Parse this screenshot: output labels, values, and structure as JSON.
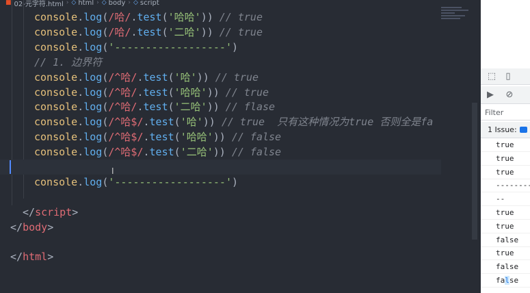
{
  "breadcrumb": {
    "file": "02-元字符.html",
    "html": "html",
    "body": "body",
    "script": "script"
  },
  "code": [
    [
      [
        "t-obj",
        "console"
      ],
      [
        "t-punc",
        "."
      ],
      [
        "t-fn",
        "log"
      ],
      [
        "t-punc",
        "("
      ],
      [
        "t-re",
        "/哈/"
      ],
      [
        "t-punc",
        "."
      ],
      [
        "t-fn",
        "test"
      ],
      [
        "t-punc",
        "("
      ],
      [
        "t-str",
        "'哈哈'"
      ],
      [
        "t-punc",
        "))"
      ],
      [
        "t-comment",
        " // true"
      ]
    ],
    [
      [
        "t-obj",
        "console"
      ],
      [
        "t-punc",
        "."
      ],
      [
        "t-fn",
        "log"
      ],
      [
        "t-punc",
        "("
      ],
      [
        "t-re",
        "/哈/"
      ],
      [
        "t-punc",
        "."
      ],
      [
        "t-fn",
        "test"
      ],
      [
        "t-punc",
        "("
      ],
      [
        "t-str",
        "'二哈'"
      ],
      [
        "t-punc",
        "))"
      ],
      [
        "t-comment",
        " // true"
      ]
    ],
    [
      [
        "t-obj",
        "console"
      ],
      [
        "t-punc",
        "."
      ],
      [
        "t-fn",
        "log"
      ],
      [
        "t-punc",
        "("
      ],
      [
        "t-str",
        "'------------------'"
      ],
      [
        "t-punc",
        ")"
      ]
    ],
    [
      [
        "t-comment",
        "// 1. 边界符"
      ]
    ],
    [
      [
        "t-obj",
        "console"
      ],
      [
        "t-punc",
        "."
      ],
      [
        "t-fn",
        "log"
      ],
      [
        "t-punc",
        "("
      ],
      [
        "t-re",
        "/^哈/"
      ],
      [
        "t-punc",
        "."
      ],
      [
        "t-fn",
        "test"
      ],
      [
        "t-punc",
        "("
      ],
      [
        "t-str",
        "'哈'"
      ],
      [
        "t-punc",
        "))"
      ],
      [
        "t-comment",
        " // true"
      ]
    ],
    [
      [
        "t-obj",
        "console"
      ],
      [
        "t-punc",
        "."
      ],
      [
        "t-fn",
        "log"
      ],
      [
        "t-punc",
        "("
      ],
      [
        "t-re",
        "/^哈/"
      ],
      [
        "t-punc",
        "."
      ],
      [
        "t-fn",
        "test"
      ],
      [
        "t-punc",
        "("
      ],
      [
        "t-str",
        "'哈哈'"
      ],
      [
        "t-punc",
        "))"
      ],
      [
        "t-comment",
        " // true"
      ]
    ],
    [
      [
        "t-obj",
        "console"
      ],
      [
        "t-punc",
        "."
      ],
      [
        "t-fn",
        "log"
      ],
      [
        "t-punc",
        "("
      ],
      [
        "t-re",
        "/^哈/"
      ],
      [
        "t-punc",
        "."
      ],
      [
        "t-fn",
        "test"
      ],
      [
        "t-punc",
        "("
      ],
      [
        "t-str",
        "'二哈'"
      ],
      [
        "t-punc",
        "))"
      ],
      [
        "t-comment",
        " // flase"
      ]
    ],
    [
      [
        "t-obj",
        "console"
      ],
      [
        "t-punc",
        "."
      ],
      [
        "t-fn",
        "log"
      ],
      [
        "t-punc",
        "("
      ],
      [
        "t-re",
        "/^哈$/"
      ],
      [
        "t-punc",
        "."
      ],
      [
        "t-fn",
        "test"
      ],
      [
        "t-punc",
        "("
      ],
      [
        "t-str",
        "'哈'"
      ],
      [
        "t-punc",
        "))"
      ],
      [
        "t-comment",
        " // true  只有这种情况为true 否则全是fa"
      ]
    ],
    [
      [
        "t-obj",
        "console"
      ],
      [
        "t-punc",
        "."
      ],
      [
        "t-fn",
        "log"
      ],
      [
        "t-punc",
        "("
      ],
      [
        "t-re",
        "/^哈$/"
      ],
      [
        "t-punc",
        "."
      ],
      [
        "t-fn",
        "test"
      ],
      [
        "t-punc",
        "("
      ],
      [
        "t-str",
        "'哈哈'"
      ],
      [
        "t-punc",
        "))"
      ],
      [
        "t-comment",
        " // false"
      ]
    ],
    [
      [
        "t-obj",
        "console"
      ],
      [
        "t-punc",
        "."
      ],
      [
        "t-fn",
        "log"
      ],
      [
        "t-punc",
        "("
      ],
      [
        "t-re",
        "/^哈$/"
      ],
      [
        "t-punc",
        "."
      ],
      [
        "t-fn",
        "test"
      ],
      [
        "t-punc",
        "("
      ],
      [
        "t-str",
        "'二哈'"
      ],
      [
        "t-punc",
        "))"
      ],
      [
        "t-comment",
        " // false"
      ]
    ],
    [],
    [
      [
        "t-obj",
        "console"
      ],
      [
        "t-punc",
        "."
      ],
      [
        "t-fn",
        "log"
      ],
      [
        "t-punc",
        "("
      ],
      [
        "t-str",
        "'------------------'"
      ],
      [
        "t-punc",
        ")"
      ]
    ],
    [],
    [
      [
        "t-punc",
        "</"
      ],
      [
        "t-tag",
        "script"
      ],
      [
        "t-punc",
        ">"
      ]
    ],
    [
      [
        "t-punc",
        "</"
      ],
      [
        "t-tag",
        "body"
      ],
      [
        "t-punc",
        ">"
      ]
    ],
    [],
    [
      [
        "t-punc",
        "</"
      ],
      [
        "t-tag",
        "html"
      ],
      [
        "t-punc",
        ">"
      ]
    ]
  ],
  "devtools": {
    "filter_placeholder": "Filter",
    "issues_label": "1 Issue:",
    "console_output": [
      "true",
      "true",
      "true",
      "-----------",
      "--",
      "true",
      "true",
      "false",
      "true",
      "false",
      "false",
      "----------"
    ]
  },
  "colors": {
    "editor_bg": "#282c34",
    "devtools_bg": "#ffffff",
    "accent": "#1a73e8"
  }
}
